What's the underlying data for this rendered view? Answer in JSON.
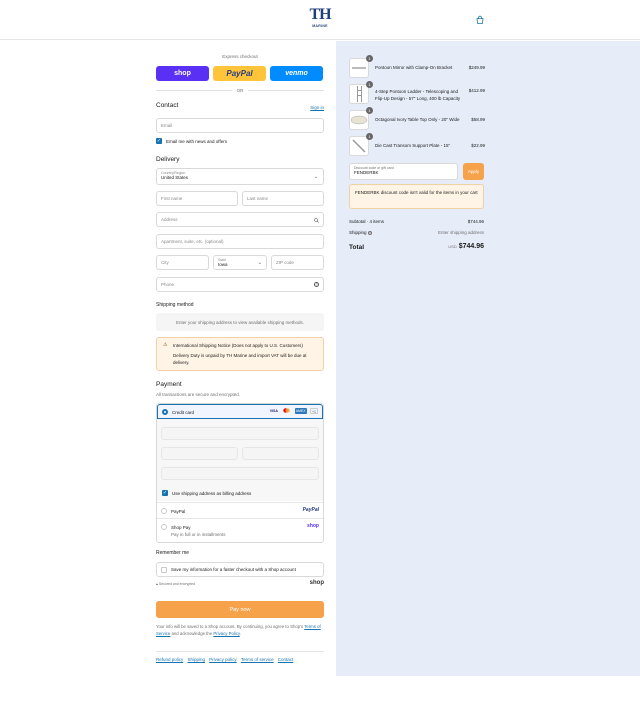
{
  "header": {
    "brand_mark": "TH",
    "brand_sub": "MARINE",
    "bag_icon": "shopping-bag-icon"
  },
  "express": {
    "label": "Express checkout",
    "shop": "shop",
    "paypal": "PayPal",
    "venmo": "venmo",
    "or": "OR"
  },
  "contact": {
    "title": "Contact",
    "sign_in": "Sign in",
    "email_placeholder": "Email",
    "news_label": "Email me with news and offers",
    "news_checked": true
  },
  "delivery": {
    "title": "Delivery",
    "country_label": "Country/Region",
    "country_value": "United States",
    "first_name": "First name",
    "last_name": "Last name",
    "address": "Address",
    "apartment": "Apartment, suite, etc. (optional)",
    "city": "City",
    "state_label": "State",
    "state_value": "Iowa",
    "zip": "ZIP code",
    "phone": "Phone"
  },
  "shipping": {
    "title": "Shipping method",
    "placeholder": "Enter your shipping address to view available shipping methods.",
    "notice_title": "International Shipping Notice (Does not apply to U.S. Customers)",
    "notice_body": "Delivery Duty is unpaid by TH Marine and import VAT will be due at delivery."
  },
  "payment": {
    "title": "Payment",
    "subtitle": "All transactions are secure and encrypted.",
    "credit_card": "Credit card",
    "more_cards": "+1",
    "billing_label": "Use shipping address as billing address",
    "paypal": "PayPal",
    "paypal_logo": "PayPal",
    "shop_pay": "Shop Pay",
    "shop_pay_sub": "Pay in full or in installments",
    "shop_logo": "shop"
  },
  "remember": {
    "title": "Remember me",
    "save_label": "Save my information for a faster checkout with a Shop account",
    "secure": "Secured and encrypted",
    "shop_logo": "shop"
  },
  "pay_now": "Pay now",
  "legal": {
    "line1": "Your info will be saved to a Shop account. By continuing, you agree to Shop's",
    "terms": "Terms of Service",
    "mid": " and acknowledge the ",
    "privacy": "Privacy Policy",
    "end": "."
  },
  "footer_links": [
    "Refund policy",
    "Shipping",
    "Privacy policy",
    "Terms of service",
    "Contact"
  ],
  "cart": {
    "items": [
      {
        "qty": "1",
        "name": "Pontoon Mirror with Clamp-On Bracket",
        "price": "$249.99"
      },
      {
        "qty": "1",
        "name": "4-Step Pontoon Ladder - Telescoping and Flip-Up Design - 57\" Long, 400 lb Capacity",
        "price": "$412.99"
      },
      {
        "qty": "1",
        "name": "Octagonal Ivory Table Top Only - 20\" Wide",
        "price": "$58.99"
      },
      {
        "qty": "1",
        "name": "Die Cast Transom Support Plate - 15\"",
        "price": "$22.99"
      }
    ],
    "discount_label": "Discount code or gift card",
    "discount_value": "FENDERBK",
    "apply": "Apply",
    "discount_error": "FENDERBK discount code isn't valid for the items in your cart",
    "subtotal_label": "Subtotal · 4 items",
    "subtotal": "$744.96",
    "shipping_label": "Shipping",
    "shipping_value": "Enter shipping address",
    "total_label": "Total",
    "currency": "USD",
    "total": "$744.96"
  }
}
